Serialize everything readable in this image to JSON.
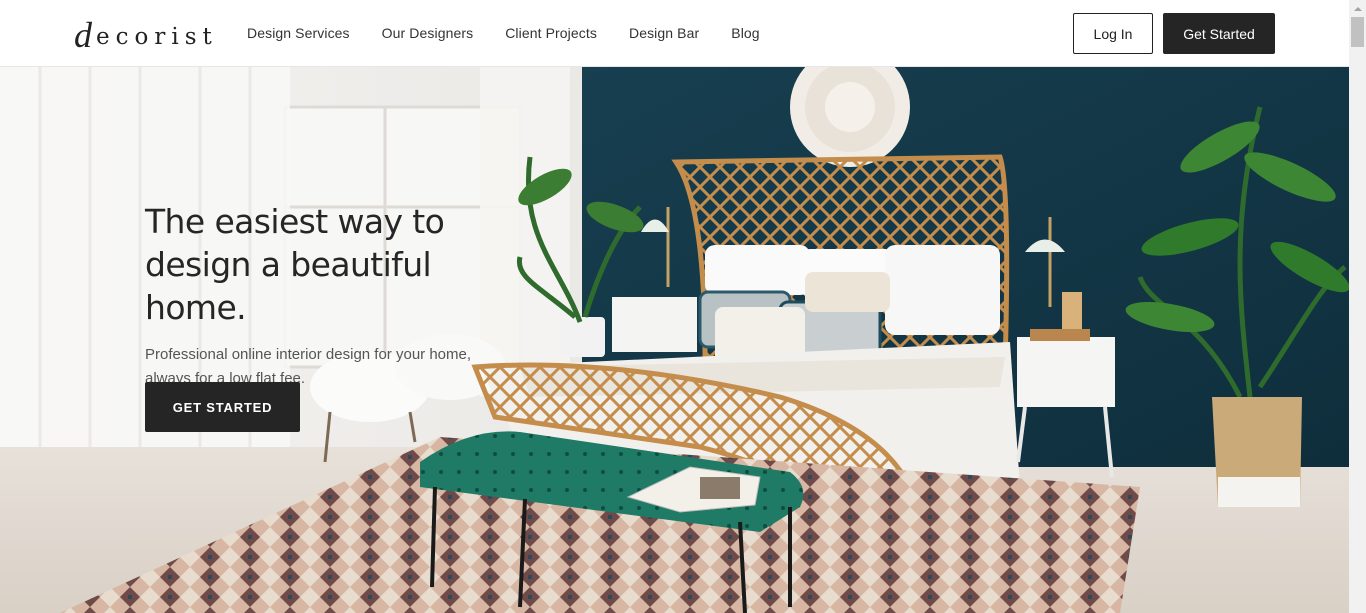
{
  "brand": {
    "logo_first": "d",
    "logo_rest": "ecorist"
  },
  "nav": {
    "items": [
      {
        "label": "Design Services"
      },
      {
        "label": "Our Designers"
      },
      {
        "label": "Client Projects"
      },
      {
        "label": "Design Bar"
      },
      {
        "label": "Blog"
      }
    ]
  },
  "header": {
    "login_label": "Log In",
    "get_started_label": "Get Started"
  },
  "hero": {
    "headline": "The easiest way to design a beautiful home.",
    "subcopy": "Professional online interior design for your home, always for a low flat fee.",
    "cta_label": "GET STARTED"
  },
  "colors": {
    "dark_button": "#252525",
    "accent_wall": "#163a4a",
    "bench": "#1f7a66"
  }
}
